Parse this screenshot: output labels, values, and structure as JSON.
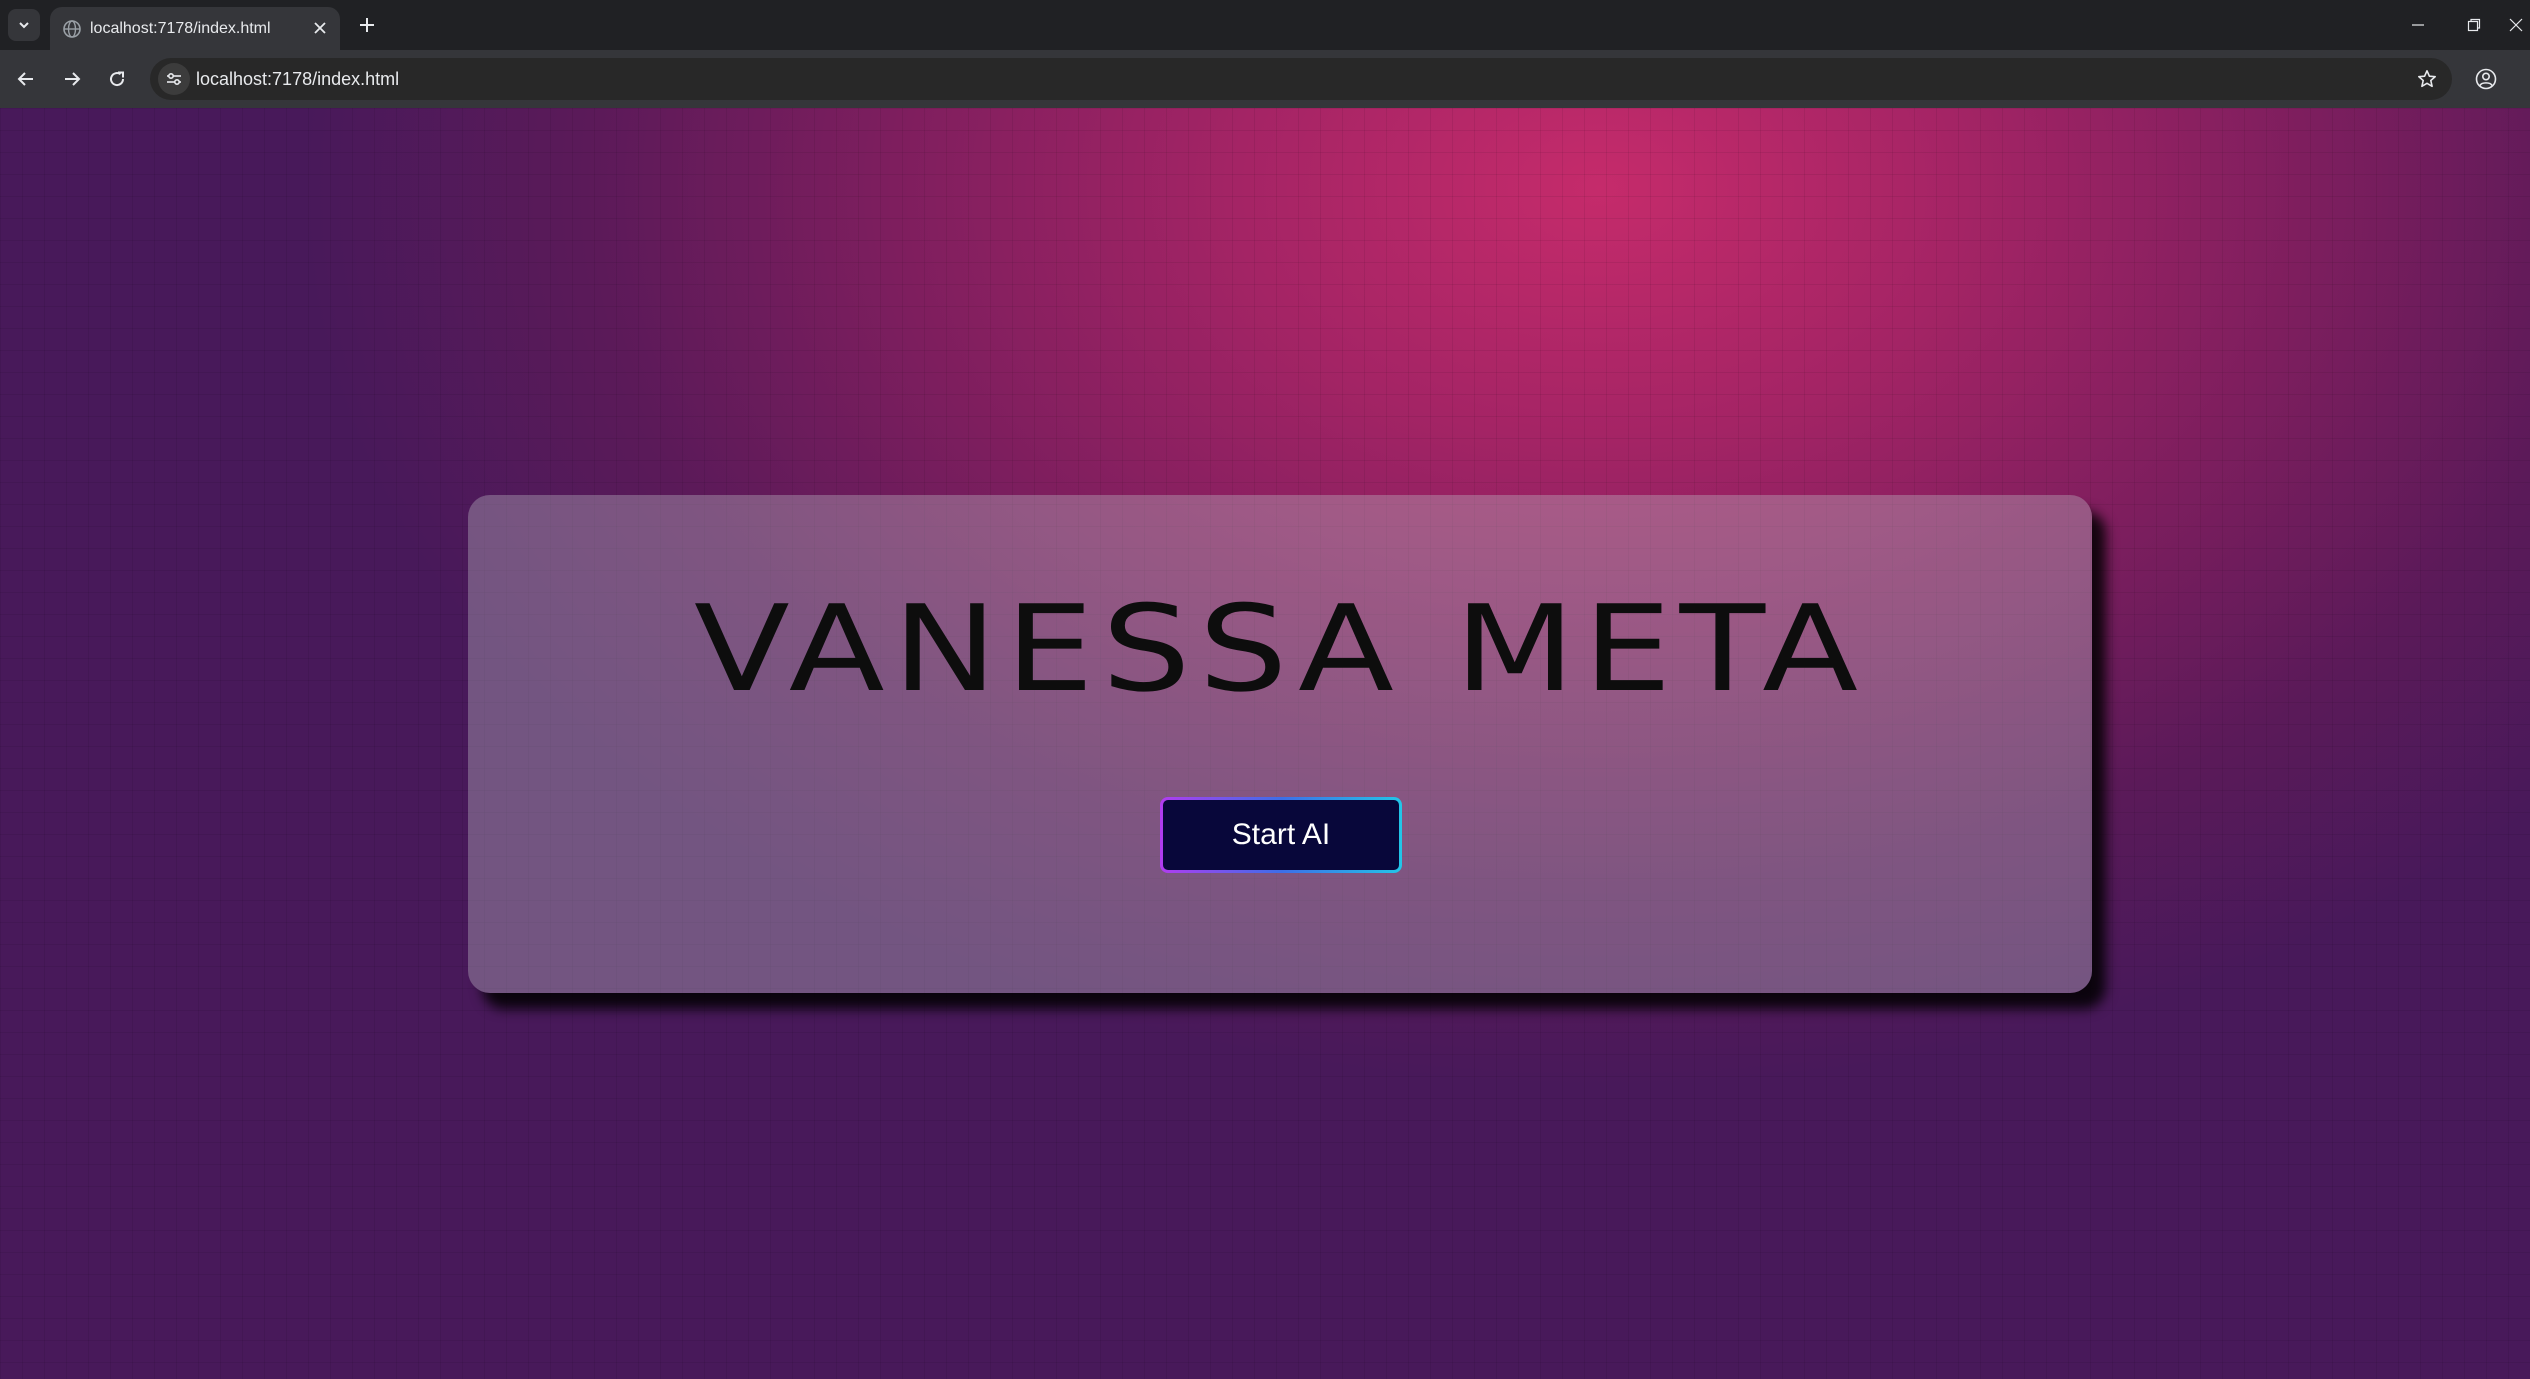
{
  "browser": {
    "tab": {
      "title": "localhost:7178/index.html"
    },
    "address_bar": {
      "url": "localhost:7178/index.html"
    },
    "icons": {
      "tab_search": "chevron-down-icon",
      "favicon": "globe-icon",
      "tab_close": "close-icon",
      "new_tab": "plus-icon",
      "back": "arrow-left-icon",
      "forward": "arrow-right-icon",
      "reload": "reload-icon",
      "site_info": "tune-icon",
      "bookmark": "star-icon",
      "profile": "profile-icon",
      "minimize": "minimize-icon",
      "restore": "restore-icon",
      "close_window": "close-icon"
    }
  },
  "page": {
    "title": "VANESSA META",
    "start_button_label": "Start AI",
    "colors": {
      "background_glow": "#c52b6b",
      "background_edge": "#48195a",
      "button_fill": "#08073a",
      "button_border_start": "#b13cf0",
      "button_border_end": "#22c6e8"
    }
  }
}
